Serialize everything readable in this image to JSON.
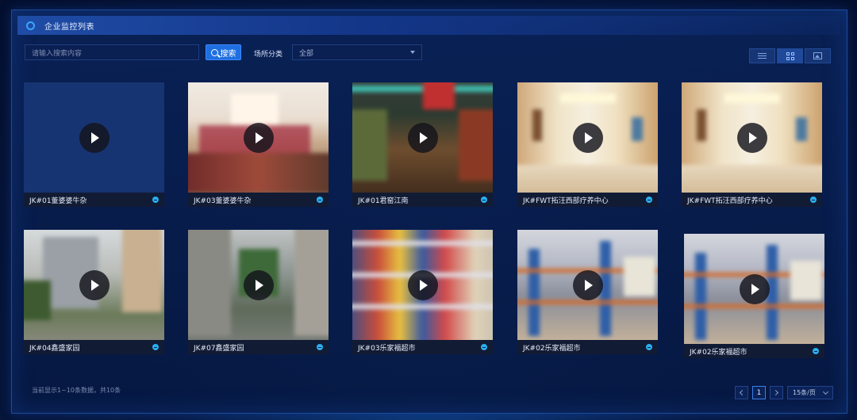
{
  "header": {
    "title": "企业监控列表"
  },
  "toolbar": {
    "search_placeholder": "请输入搜索内容",
    "search_label": "搜索",
    "category_label": "场所分类",
    "category_value": "全部"
  },
  "cameras": [
    {
      "name": "JK#01董婆婆牛杂",
      "scene": "empty"
    },
    {
      "name": "JK#03董婆婆牛杂",
      "scene": "restaurant"
    },
    {
      "name": "JK#01君窑江南",
      "scene": "restaurant-dark"
    },
    {
      "name": "JK#FWT拓汪西部疗养中心",
      "scene": "hallway"
    },
    {
      "name": "JK#FWT拓汪西部疗养中心",
      "scene": "hallway"
    },
    {
      "name": "JK#04鑫盛家园",
      "scene": "buildings"
    },
    {
      "name": "JK#07鑫盛家园",
      "scene": "alley"
    },
    {
      "name": "JK#03乐家福超市",
      "scene": "supermarket"
    },
    {
      "name": "JK#02乐家福超市",
      "scene": "warehouse"
    },
    {
      "name": "JK#02乐家福超市",
      "scene": "warehouse"
    }
  ],
  "footer": {
    "total_text": "当前显示1~10条数据，共10条",
    "current_page": "1",
    "page_size": "15条/页"
  },
  "colors": {
    "accent": "#1f6fe0",
    "badge": "#2ab0f0",
    "background": "#061a44"
  }
}
